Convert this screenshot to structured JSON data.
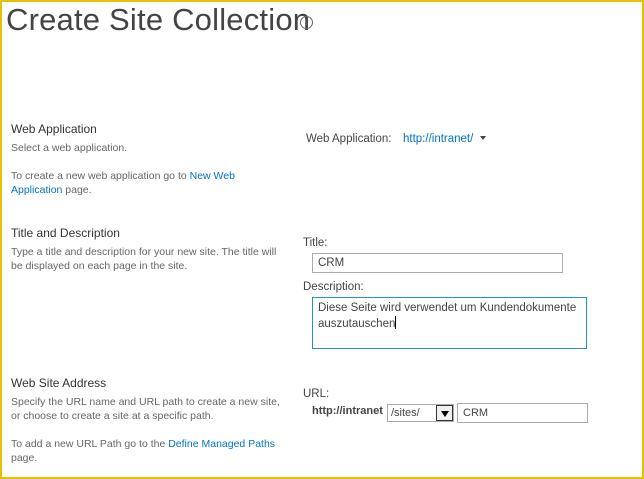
{
  "page": {
    "title": "Create Site Collection",
    "info_icon": "info-icon"
  },
  "web_application": {
    "section_title": "Web Application",
    "help": "Select a web application.",
    "create_prefix": "To create a new web application go to ",
    "create_link": "New Web Application",
    "create_suffix": " page.",
    "label": "Web Application:",
    "value": "http://intranet/"
  },
  "title_description": {
    "section_title": "Title and Description",
    "help": "Type a title and description for your new site. The title will be displayed on each page in the site.",
    "title_label": "Title:",
    "title_value": "CRM",
    "description_label": "Description:",
    "description_value": "Diese Seite wird verwendet um Kundendokumente auszutauschen"
  },
  "web_site_address": {
    "section_title": "Web Site Address",
    "help": "Specify the URL name and URL path to create a new site, or choose to create a site at a specific path.",
    "add_prefix": "To add a new URL Path go to the ",
    "add_link": "Define Managed Paths",
    "add_suffix": " page.",
    "url_label": "URL:",
    "url_prefix": "http://intranet",
    "path_selected": "/sites/",
    "site_name": "CRM"
  }
}
